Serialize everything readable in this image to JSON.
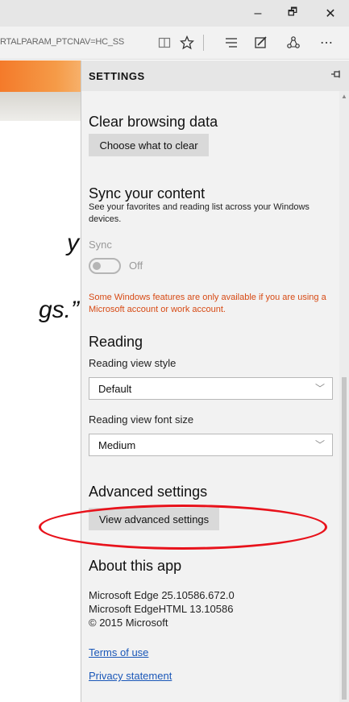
{
  "window": {
    "minimize_glyph": "–",
    "restore_glyph": "🗗",
    "close_glyph": "✕"
  },
  "toolbar": {
    "url": "RTALPARAM_PTCNAV=HC_SS",
    "icons": [
      "reading-view-icon",
      "favorites-star-icon",
      "hub-icon",
      "web-note-icon",
      "share-icon",
      "more-icon"
    ]
  },
  "page": {
    "quote_line1": "y",
    "quote_line2": "gs.”"
  },
  "settings": {
    "title": "SETTINGS",
    "clear": {
      "title": "Clear browsing data",
      "button": "Choose what to clear"
    },
    "sync": {
      "title": "Sync your content",
      "description": "See your favorites and reading list across your Windows devices.",
      "label": "Sync",
      "state": "Off",
      "warning": "Some Windows features are only available if you are using a Microsoft account or work account."
    },
    "reading": {
      "title": "Reading",
      "style_label": "Reading view style",
      "style_value": "Default",
      "font_label": "Reading view font size",
      "font_value": "Medium"
    },
    "advanced": {
      "title": "Advanced settings",
      "button": "View advanced settings"
    },
    "about": {
      "title": "About this app",
      "line1": "Microsoft Edge 25.10586.672.0",
      "line2": "Microsoft EdgeHTML 13.10586",
      "line3": "© 2015 Microsoft",
      "terms": "Terms of use",
      "privacy": "Privacy statement"
    }
  },
  "colors": {
    "accent_orange": "#f47a2a",
    "warning_text": "#d74a14",
    "link": "#1a57b8",
    "annotation_red": "#e8121b"
  }
}
